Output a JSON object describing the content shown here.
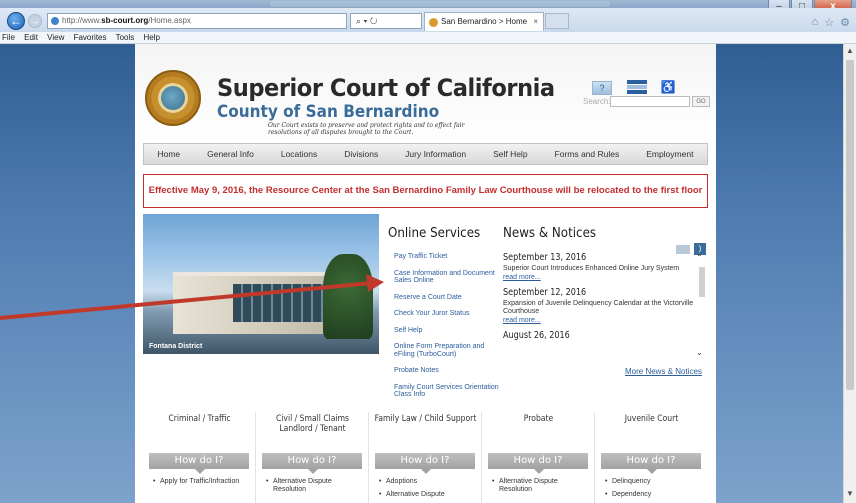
{
  "browser": {
    "url_prefix": "http://www.",
    "url_domain": "sb-court.org",
    "url_path": "/Home.aspx",
    "addr_tools": "⌕ ▾ ↻",
    "tab_title": "San Bernardino > Home",
    "tab_close": "×",
    "back_glyph": "←",
    "fwd_glyph": "→",
    "win_min": "–",
    "win_max": "□",
    "win_close": "x",
    "right_icons": [
      "home-icon",
      "favorites-icon",
      "tools-icon"
    ],
    "right_glyphs": [
      "⌂",
      "☆",
      "⚙"
    ],
    "menu": [
      "File",
      "Edit",
      "View",
      "Favorites",
      "Tools",
      "Help"
    ],
    "scroll_up": "▲",
    "scroll_down": "▼"
  },
  "header": {
    "title_main": "Superior Court of California",
    "title_sub": "County of San Bernardino",
    "motto": "Our Court exists to preserve and protect rights and to effect fair resolutions of all disputes brought to the Court.",
    "help_glyph": "?",
    "access_glyph": "♿",
    "search_label": "Search:",
    "search_go": "GO"
  },
  "nav": [
    "Home",
    "General Info",
    "Locations",
    "Divisions",
    "Jury Information",
    "Self Help",
    "Forms and Rules",
    "Employment"
  ],
  "alert": "Effective May 9, 2016, the Resource Center at the San Bernardino Family Law Courthouse will be relocated to the first floor",
  "photo_caption": "Fontana District",
  "online_services": {
    "title": "Online Services",
    "items": [
      "Pay Traffic Ticket",
      "Case Information and Document Sales Online",
      "Reserve a Court Date",
      "Check Your Juror Status",
      "Self Help",
      "Online Form Preparation and eFiling (TurboCourt)",
      "Probate Notes",
      "Family Court Services Orientation Class Info"
    ]
  },
  "news": {
    "title": "News & Notices",
    "rss_glyph": ")",
    "items": [
      {
        "date": "September 13, 2016",
        "text": "Superior Court Introduces Enhanced Online Jury System",
        "link": "read more..."
      },
      {
        "date": "September 12, 2016",
        "text": "Expansion of Juvenile Delinquency Calendar at the Victorville Courthouse",
        "link": "read more..."
      },
      {
        "date": "August 26, 2016",
        "text": "",
        "link": ""
      }
    ],
    "more": "More News & Notices",
    "scroll_up": "⌃",
    "scroll_down": "⌄"
  },
  "categories": [
    {
      "title": "Criminal / Traffic",
      "how": "How do I?",
      "items": [
        "Apply for Traffic/Infraction"
      ]
    },
    {
      "title": "Civil / Small Claims Landlord / Tenant",
      "how": "How do I?",
      "items": [
        "Alternative Dispute Resolution"
      ]
    },
    {
      "title": "Family Law / Child Support",
      "how": "How do I?",
      "items": [
        "Adoptions",
        "Alternative Dispute"
      ]
    },
    {
      "title": "Probate",
      "how": "How do I?",
      "items": [
        "Alternative Dispute Resolution"
      ]
    },
    {
      "title": "Juvenile Court",
      "how": "How do I?",
      "items": [
        "Delinquency",
        "Dependency"
      ]
    }
  ],
  "colors": {
    "alert": "#c42d2d",
    "link": "#2b5d9c",
    "annotation_arrow": "#c0392b"
  }
}
